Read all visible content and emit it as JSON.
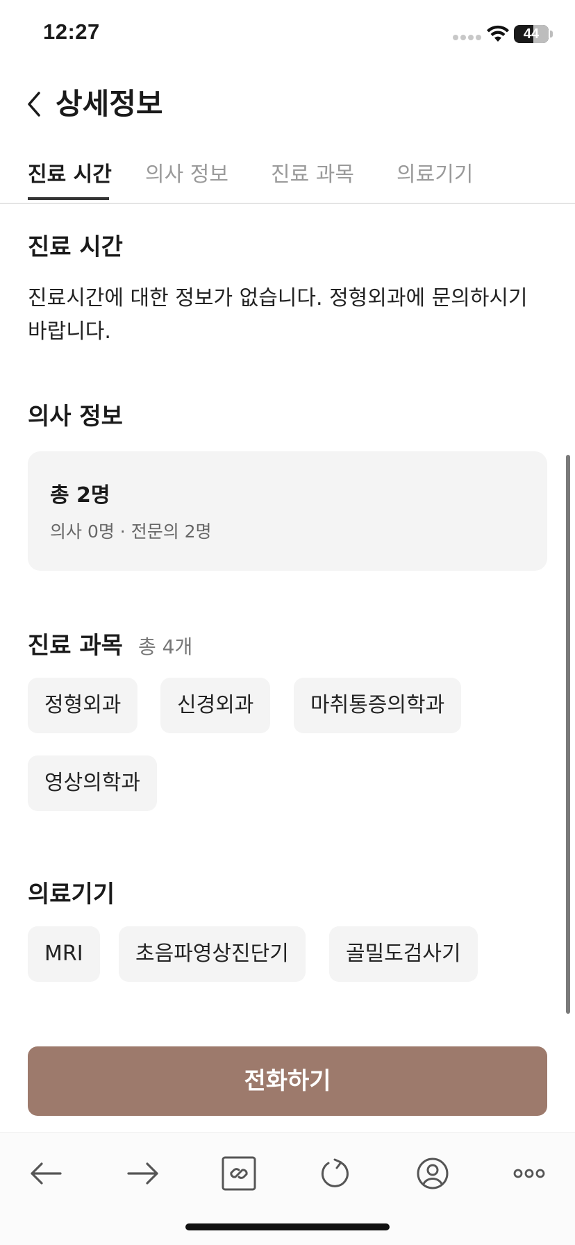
{
  "status_bar": {
    "time": "12:27",
    "battery_level": "44"
  },
  "header": {
    "title": "상세정보"
  },
  "tabs": [
    {
      "label": "진료 시간",
      "active": true
    },
    {
      "label": "의사 정보",
      "active": false
    },
    {
      "label": "진료 과목",
      "active": false
    },
    {
      "label": "의료기기",
      "active": false
    }
  ],
  "hours": {
    "title": "진료 시간",
    "text": "진료시간에 대한 정보가 없습니다. 정형외과에 문의하시기 바랍니다."
  },
  "doctors": {
    "title": "의사 정보",
    "total": "총 2명",
    "breakdown": "의사 0명 · 전문의 2명"
  },
  "departments": {
    "title": "진료 과목",
    "count": "총 4개",
    "items": [
      "정형외과",
      "신경외과",
      "마취통증의학과",
      "영상의학과"
    ]
  },
  "equipment": {
    "title": "의료기기",
    "items": [
      "MRI",
      "초음파영상진단기",
      "골밀도검사기"
    ]
  },
  "call_button": {
    "label": "전화하기",
    "color": "#9d7a6c"
  },
  "toolbar": {
    "icons": [
      "back-arrow-icon",
      "forward-arrow-icon",
      "link-icon",
      "refresh-icon",
      "profile-icon",
      "more-icon"
    ]
  }
}
